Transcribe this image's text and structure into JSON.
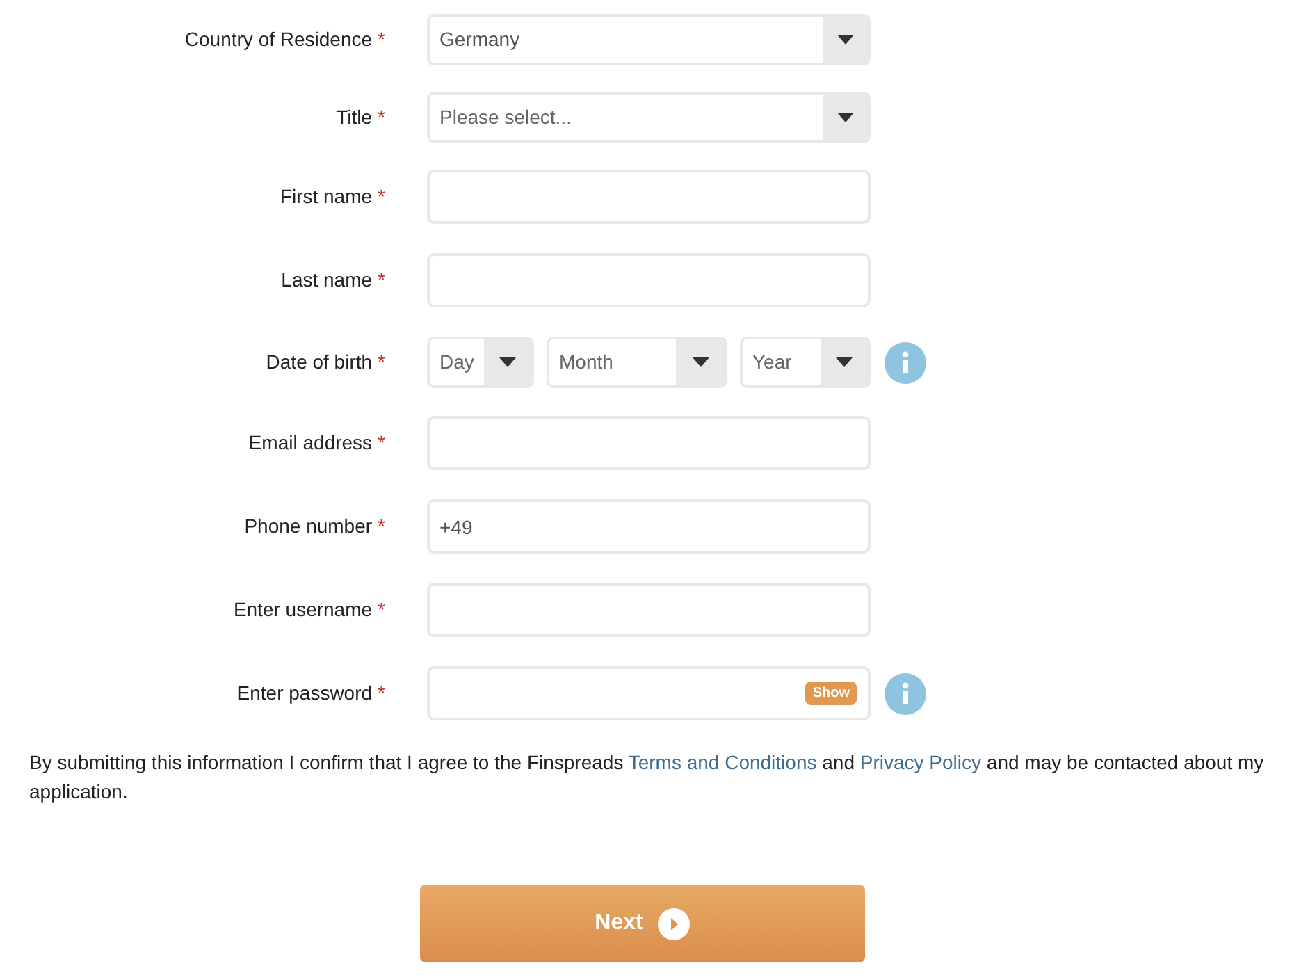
{
  "fields": [
    {
      "kind": "select",
      "label": "Country of Residence",
      "required_mark": "*",
      "value": "Germany"
    },
    {
      "kind": "select",
      "label": "Title",
      "required_mark": "*",
      "placeholder": "Please select..."
    },
    {
      "kind": "text",
      "label": "First name",
      "required_mark": "*"
    },
    {
      "kind": "text",
      "label": "Last name",
      "required_mark": "*"
    },
    {
      "kind": "date",
      "label": "Date of birth",
      "required_mark": "*",
      "parts": [
        {
          "placeholder": "Day"
        },
        {
          "placeholder": "Month"
        },
        {
          "placeholder": "Year"
        }
      ],
      "info": true
    },
    {
      "kind": "text",
      "label": "Email address",
      "required_mark": "*"
    },
    {
      "kind": "text",
      "label": "Phone number",
      "required_mark": "*",
      "value": "+49"
    },
    {
      "kind": "text",
      "label": "Enter username",
      "required_mark": "*"
    },
    {
      "kind": "password",
      "label": "Enter password",
      "required_mark": "*",
      "toggle": "Show",
      "info": true
    }
  ],
  "consent": {
    "parts": [
      {
        "kind": "text",
        "text": "By submitting this information I confirm that I agree to the Finspreads"
      },
      {
        "kind": "link",
        "text": "Terms and Conditions"
      },
      {
        "kind": "text",
        "text": "and"
      },
      {
        "kind": "link",
        "text": "Privacy Policy"
      },
      {
        "kind": "text",
        "text": "and may be contacted about my application."
      }
    ]
  },
  "next_button": {
    "label": "Next"
  }
}
